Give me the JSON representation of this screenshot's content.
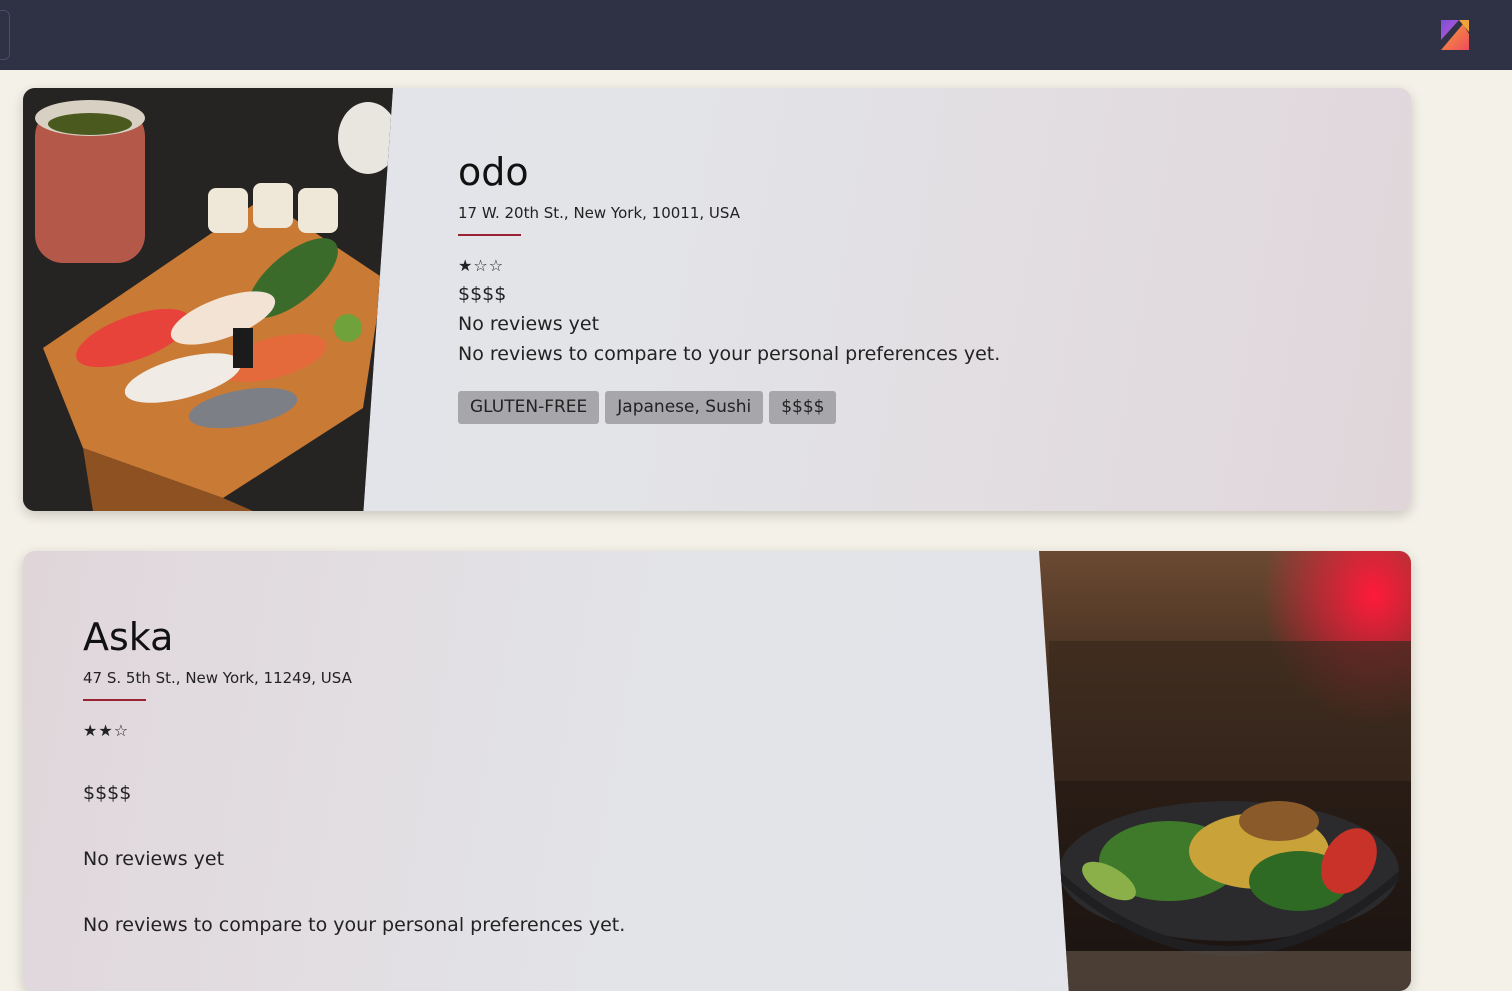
{
  "restaurants": [
    {
      "name": "odo",
      "address": "17 W. 20th St., New York, 10011, USA",
      "rating_stars": "★☆☆",
      "rating": 1,
      "price": "$$$$",
      "reviews": "No reviews yet",
      "compare": "No reviews to compare to your personal preferences yet.",
      "tags": [
        "GLUTEN-FREE",
        "Japanese, Sushi",
        "$$$$"
      ],
      "image": "sushi-platter-photo"
    },
    {
      "name": "Aska",
      "address": "47 S. 5th St., New York, 11249, USA",
      "rating_stars": "★★☆",
      "rating": 2,
      "price": "$$$$",
      "reviews": "No reviews yet",
      "compare": "No reviews to compare to your personal preferences yet.",
      "image": "salad-bowl-photo"
    }
  ],
  "colors": {
    "topbar": "#2f3144",
    "page_background": "#f4f1e8",
    "divider_accent": "#9a2233",
    "tag_background": "#a6a6ab"
  },
  "icons": {
    "app_logo": "app-logo-icon"
  }
}
